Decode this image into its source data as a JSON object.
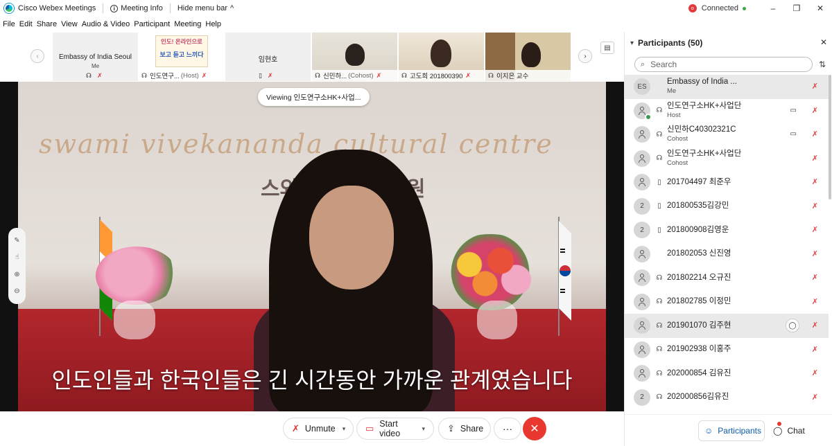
{
  "titlebar": {
    "app_title": "Cisco Webex Meetings",
    "meeting_info": "Meeting Info",
    "hide_menu": "Hide menu bar",
    "hide_menu_chevron": "^",
    "status": "Connected",
    "status_color": "#3ba84e",
    "window_controls": [
      "–",
      "❐",
      "✕"
    ]
  },
  "menu": [
    "File",
    "Edit",
    "Share",
    "View",
    "Audio & Video",
    "Participant",
    "Meeting",
    "Help"
  ],
  "thumbnails": [
    {
      "name": "Embassy of India Seoul",
      "sub": "Me",
      "foot": ""
    },
    {
      "name": "",
      "sub": "",
      "foot": "인도연구...",
      "role": "(Host)",
      "poster_top": "인도! 온라인으로",
      "poster_bottom": "보고 듣고 느끼다"
    },
    {
      "name": "임현호",
      "sub": "",
      "foot": ""
    },
    {
      "name": "",
      "sub": "",
      "foot": "신민하...",
      "role": "(Cohost)"
    },
    {
      "name": "",
      "sub": "",
      "foot": "고도희 201800390"
    },
    {
      "name": "",
      "sub": "",
      "foot": "이지은 교수"
    }
  ],
  "video": {
    "viewing": "Viewing 인도연구소HK+사업...",
    "sign_en": "swami vivekananda cultural centre",
    "sign_ko": "스와미 비베          문화원",
    "subtitle": "인도인들과 한국인들은 긴 시간동안 가까운 관계였습니다"
  },
  "controls": {
    "unmute": "Unmute",
    "start_video": "Start video",
    "share": "Share",
    "more": "···",
    "end": "✕",
    "end_color": "#e8382f"
  },
  "panel": {
    "title": "Participants (50)",
    "search_placeholder": "Search",
    "participants": [
      {
        "initials": "ES",
        "name": "Embassy of India ...",
        "role": "Me",
        "device": "",
        "video": false,
        "chat": false,
        "highlight": true
      },
      {
        "initials": "",
        "name": "인도연구소HK+사업단",
        "role": "Host",
        "device": "headset",
        "video": true,
        "chat": false,
        "host": true
      },
      {
        "initials": "",
        "name": "신민하C40302321C",
        "role": "Cohost",
        "device": "headset",
        "video": true,
        "chat": false
      },
      {
        "initials": "",
        "name": "인도연구소HK+사업단",
        "role": "Cohost",
        "device": "headset",
        "video": false,
        "chat": false
      },
      {
        "initials": "",
        "name": "201704497 최준우",
        "role": "",
        "device": "phone",
        "video": false,
        "chat": false
      },
      {
        "initials": "2",
        "name": "201800535김강민",
        "role": "",
        "device": "phone",
        "video": false,
        "chat": false
      },
      {
        "initials": "2",
        "name": "201800908김영운",
        "role": "",
        "device": "phone",
        "video": false,
        "chat": false
      },
      {
        "initials": "",
        "name": "201802053 신진영",
        "role": "",
        "device": "",
        "video": false,
        "chat": false
      },
      {
        "initials": "",
        "name": "201802214 오규진",
        "role": "",
        "device": "headset",
        "video": false,
        "chat": false
      },
      {
        "initials": "",
        "name": "201802785 이정민",
        "role": "",
        "device": "headset",
        "video": false,
        "chat": false
      },
      {
        "initials": "",
        "name": "201901070 김주현",
        "role": "",
        "device": "headset",
        "video": false,
        "chat": true,
        "highlight": true
      },
      {
        "initials": "",
        "name": "201902938 이홍주",
        "role": "",
        "device": "headset",
        "video": false,
        "chat": false
      },
      {
        "initials": "",
        "name": "202000854 김유진",
        "role": "",
        "device": "headset",
        "video": false,
        "chat": false
      },
      {
        "initials": "2",
        "name": "202000856김유진",
        "role": "",
        "device": "headset",
        "video": false,
        "chat": false
      }
    ],
    "footer": {
      "participants": "Participants",
      "chat": "Chat"
    }
  }
}
